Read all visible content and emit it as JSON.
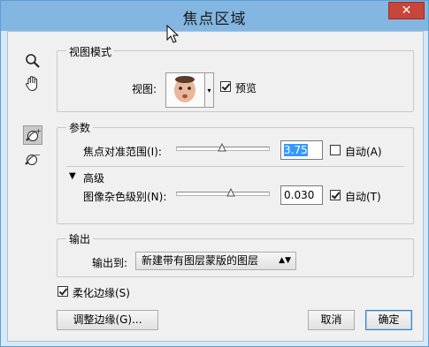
{
  "window": {
    "title": "焦点区域",
    "close_glyph": "✕"
  },
  "tools": [
    {
      "name": "zoom-icon"
    },
    {
      "name": "hand-icon"
    },
    {
      "name": "add-focus-brush-icon"
    },
    {
      "name": "subtract-focus-brush-icon"
    }
  ],
  "view_mode": {
    "legend": "视图模式",
    "view_label": "视图:",
    "preview_label": "预览",
    "preview_checked": true
  },
  "params": {
    "legend": "参数",
    "focus_range_label": "焦点对准范围(I):",
    "focus_range_value": "3.75",
    "focus_range_slider_fraction": 0.5,
    "auto_a_label": "自动(A)",
    "auto_a_checked": false,
    "advanced_label": "高级",
    "noise_label": "图像杂色级别(N):",
    "noise_value": "0.030",
    "noise_slider_fraction": 0.6,
    "auto_t_label": "自动(T)",
    "auto_t_checked": true
  },
  "output": {
    "legend": "输出",
    "output_to_label": "输出到:",
    "output_to_value": "新建带有图层蒙版的图层"
  },
  "soften_edges": {
    "label": "柔化边缘(S)",
    "checked": true
  },
  "buttons": {
    "refine_edge": "调整边缘(G)...",
    "cancel": "取消",
    "ok": "确定"
  },
  "colors": {
    "title_bar": "#83b7e2",
    "close_button": "#c7453b",
    "selection": "#3399ff"
  }
}
